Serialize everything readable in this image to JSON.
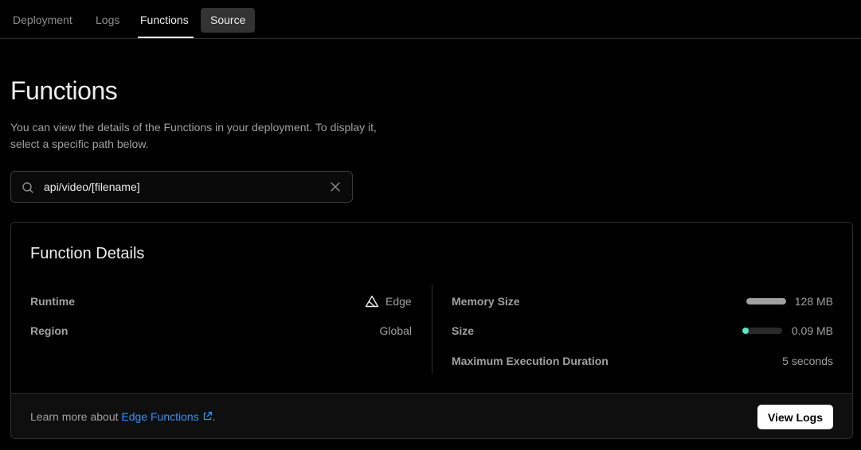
{
  "tabs": [
    {
      "label": "Deployment"
    },
    {
      "label": "Logs"
    },
    {
      "label": "Functions"
    },
    {
      "label": "Source"
    }
  ],
  "page": {
    "title": "Functions",
    "description": "You can view the details of the Functions in your deployment. To display it, select a specific path below."
  },
  "search": {
    "value": "api/video/[filename]",
    "icon": "search-icon",
    "clear_icon": "close-icon"
  },
  "details": {
    "title": "Function Details",
    "runtime_label": "Runtime",
    "runtime_value": "Edge",
    "region_label": "Region",
    "region_value": "Global",
    "memory_label": "Memory Size",
    "memory_value": "128 MB",
    "memory_fill": 1.0,
    "memory_color": "#a1a1a1",
    "size_label": "Size",
    "size_value": "0.09 MB",
    "size_fill": 0.15,
    "size_color": "#5ee6c8",
    "duration_label": "Maximum Execution Duration",
    "duration_value": "5 seconds"
  },
  "footer": {
    "prefix": "Learn more about ",
    "link": "Edge Functions",
    "suffix": ".",
    "button": "View Logs"
  }
}
